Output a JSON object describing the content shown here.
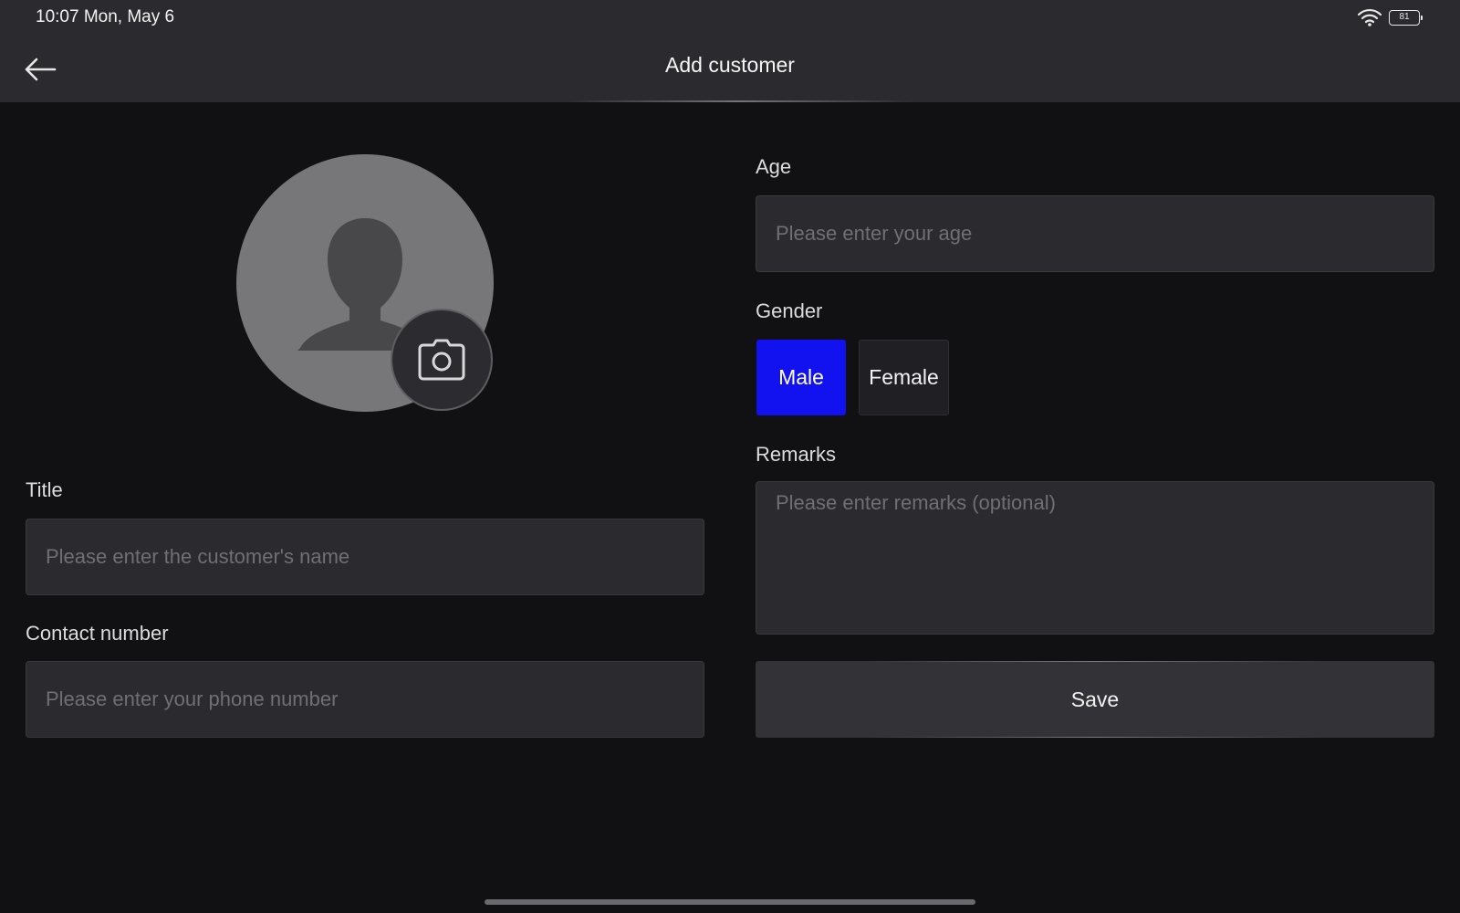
{
  "status_bar": {
    "time": "10:07 Mon, May 6",
    "battery_level": "81"
  },
  "header": {
    "title": "Add customer"
  },
  "form": {
    "title_label": "Title",
    "title_placeholder": "Please enter the customer's name",
    "contact_label": "Contact number",
    "contact_placeholder": "Please enter your phone number",
    "age_label": "Age",
    "age_placeholder": "Please enter your age",
    "gender_label": "Gender",
    "gender_options": [
      "Male",
      "Female"
    ],
    "gender_selected": "Male",
    "remarks_label": "Remarks",
    "remarks_placeholder": "Please enter remarks (optional)",
    "save_label": "Save"
  },
  "colors": {
    "accent": "#1212f0",
    "background": "#111114",
    "surface": "#2b2b2f"
  },
  "icons": {
    "back": "arrow-left-icon",
    "avatar": "person-silhouette-icon",
    "camera": "camera-icon",
    "wifi": "wifi-icon",
    "battery": "battery-icon"
  }
}
